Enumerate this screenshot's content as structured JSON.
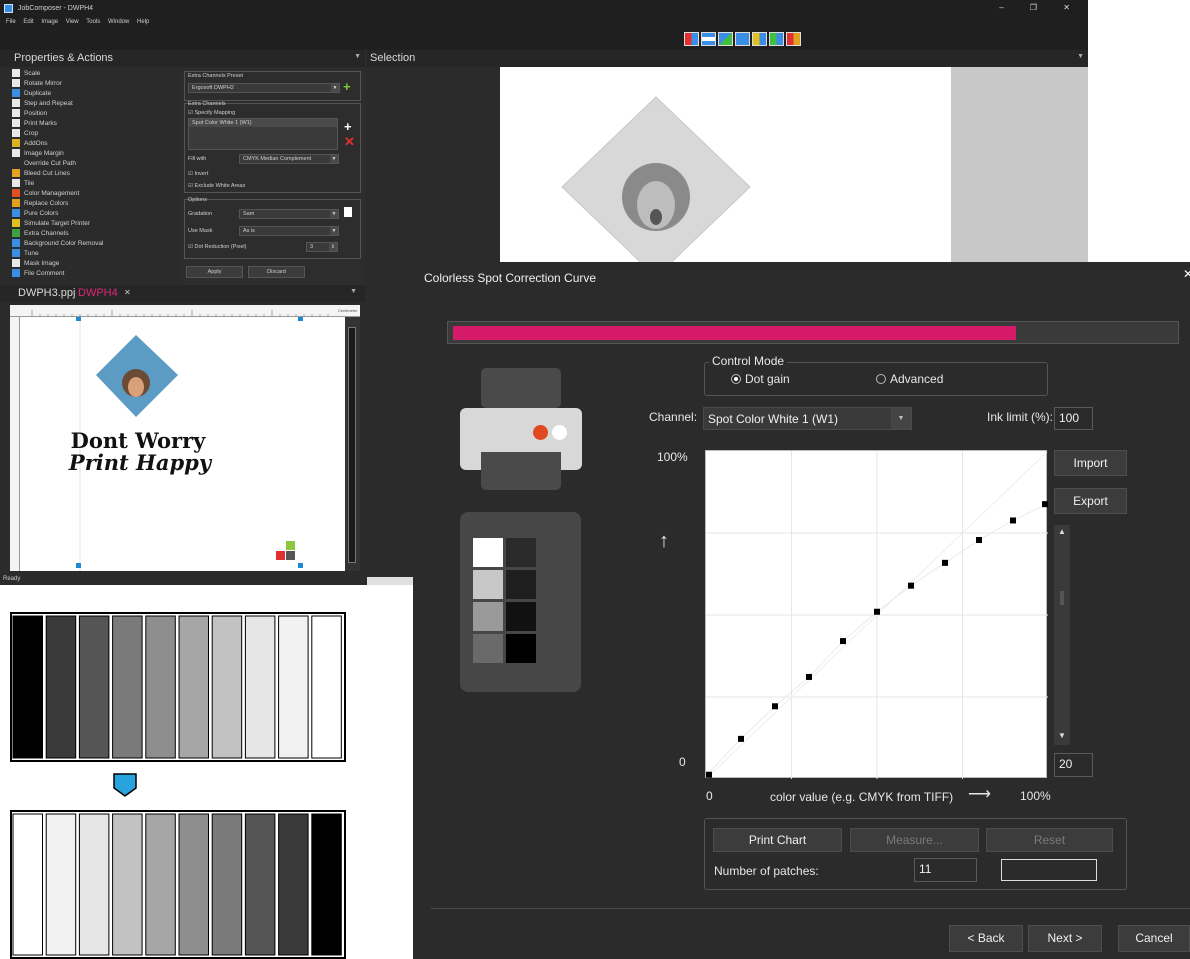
{
  "app": {
    "title": "JobComposer - DWPH4",
    "window_controls": "–  ❐  ✕",
    "menu": [
      "File",
      "Edit",
      "Image",
      "View",
      "Tools",
      "Window",
      "Help"
    ],
    "properties_header": "Properties & Actions",
    "selection_header": "Selection",
    "actions": [
      {
        "label": "Scale",
        "color": "#e8e8e8"
      },
      {
        "label": "Rotate Mirror",
        "color": "#e8e8e8"
      },
      {
        "label": "Duplicate",
        "color": "#3a8ee6"
      },
      {
        "label": "Step and Repeat",
        "color": "#e8e8e8"
      },
      {
        "label": "Position",
        "color": "#e8e8e8"
      },
      {
        "label": "Print Marks",
        "color": "#e8e8e8"
      },
      {
        "label": "Crop",
        "color": "#e8e8e8"
      },
      {
        "label": "AddOns",
        "color": "#e0b020"
      },
      {
        "label": "Image Margin",
        "color": "#e8e8e8"
      },
      {
        "label": "Override Cut Path",
        "color": "#2b2b2b"
      },
      {
        "label": "Bleed Cut Lines",
        "color": "#e8a020"
      },
      {
        "label": "Tile",
        "color": "#e8e8e8"
      },
      {
        "label": "Color Management",
        "color": "#e05020"
      },
      {
        "label": "Replace Colors",
        "color": "#e0a020"
      },
      {
        "label": "Pure Colors",
        "color": "#3a8ee6"
      },
      {
        "label": "Simulate Target Printer",
        "color": "#e0c020"
      },
      {
        "label": "Extra Channels",
        "color": "#40a040"
      },
      {
        "label": "Background Color Removal",
        "color": "#3a8ee6"
      },
      {
        "label": "Tune",
        "color": "#3a8ee6"
      },
      {
        "label": "Mask Image",
        "color": "#e8e8e8"
      },
      {
        "label": "File Comment",
        "color": "#3a8ee6"
      }
    ],
    "extra_channels": {
      "preset_label": "Extra Channels Preset",
      "preset_value": "Ergosoft DWPH2",
      "channels_label": "Extra Channels",
      "specify_mapping": "Specify Mapping",
      "channel_item": "Spot Color White 1 (W1)",
      "fill_with_label": "Fill with",
      "fill_with_value": "CMYK Median Complement",
      "invert": "Invert",
      "exclude_white": "Exclude White Areas",
      "options_label": "Options",
      "gradation_label": "Gradation",
      "gradation_value": "Sam",
      "use_mask_label": "Use Mask",
      "use_mask_value": "As is",
      "dot_reduction_label": "Dot Reduction (Pixel)",
      "dot_reduction_value": "3",
      "apply": "Apply",
      "discard": "Discard"
    },
    "doc_tabs": [
      "DWPH3.ppj",
      "DWPH4"
    ],
    "ruler_unit": "Centimeter",
    "page_text": {
      "line1": "Dont Worry",
      "line2": "Print Happy"
    },
    "status": "Ready"
  },
  "dialog": {
    "title": "Colorless Spot Correction Curve",
    "progress": 0.78,
    "progress_color": "#d51a6a",
    "control_mode_legend": "Control Mode",
    "modes": [
      {
        "label": "Dot gain",
        "selected": true
      },
      {
        "label": "Advanced",
        "selected": false
      }
    ],
    "channel_label": "Channel:",
    "channel_value": "Spot Color White 1 (W1)",
    "ink_limit_label": "Ink limit (%):",
    "ink_limit_value": "100",
    "y_top_label": "100%",
    "y_bottom_label": "0",
    "x_left_label": "0",
    "x_axis_caption": "color value (e.g. CMYK from TIFF)",
    "x_right_label": "100%",
    "import": "Import",
    "export": "Export",
    "scroll_value": "20",
    "print_chart": "Print Chart",
    "measure": "Measure...",
    "reset": "Reset",
    "patches_label": "Number of patches:",
    "patches_value": "11",
    "back": "< Back",
    "next": "Next >",
    "cancel": "Cancel",
    "swatches": {
      "left": [
        "#ffffff",
        "#c8c8c8",
        "#9a9a9a",
        "#6a6a6a"
      ],
      "right": [
        "#2a2a2a",
        "#1e1e1e",
        "#111111",
        "#000000"
      ]
    }
  },
  "chart_data": {
    "type": "scatter",
    "x": [
      0,
      10,
      20,
      30,
      40,
      50,
      60,
      70,
      80,
      90,
      100
    ],
    "y": [
      1,
      12,
      22,
      31,
      42,
      51,
      59,
      66,
      73,
      79,
      84
    ],
    "xlim": [
      0,
      100
    ],
    "ylim": [
      0,
      100
    ],
    "grid": true,
    "xlabel": "color value (e.g. CMYK from TIFF)",
    "ylabel": "",
    "title": ""
  },
  "strips": {
    "top": [
      "#000000",
      "#3a3a3a",
      "#555555",
      "#7a7a7a",
      "#8e8e8e",
      "#a6a6a6",
      "#c2c2c2",
      "#e6e6e6",
      "#f2f2f2",
      "#ffffff"
    ],
    "bottom": [
      "#ffffff",
      "#f2f2f2",
      "#e6e6e6",
      "#c2c2c2",
      "#a6a6a6",
      "#8e8e8e",
      "#7a7a7a",
      "#555555",
      "#3a3a3a",
      "#000000"
    ],
    "arrow_color": "#29a3dd"
  }
}
